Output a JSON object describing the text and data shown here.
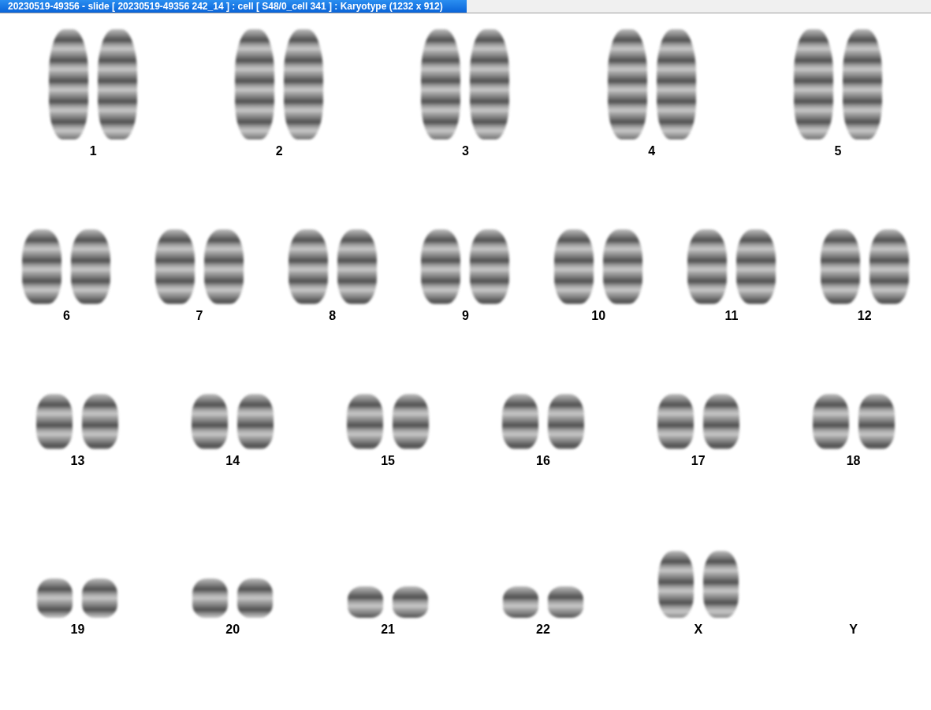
{
  "window": {
    "title": "20230519-49356 - slide [ 20230519-49356 242_14 ] : cell [ S48/0_cell 341 ] : Karyotype  (1232 x 912)"
  },
  "rows": [
    {
      "pairs": [
        {
          "label": "1",
          "has_images": true
        },
        {
          "label": "2",
          "has_images": true
        },
        {
          "label": "3",
          "has_images": true
        },
        {
          "label": "4",
          "has_images": true
        },
        {
          "label": "5",
          "has_images": true
        }
      ]
    },
    {
      "pairs": [
        {
          "label": "6",
          "has_images": true
        },
        {
          "label": "7",
          "has_images": true
        },
        {
          "label": "8",
          "has_images": true
        },
        {
          "label": "9",
          "has_images": true
        },
        {
          "label": "10",
          "has_images": true
        },
        {
          "label": "11",
          "has_images": true
        },
        {
          "label": "12",
          "has_images": true
        }
      ]
    },
    {
      "pairs": [
        {
          "label": "13",
          "has_images": true
        },
        {
          "label": "14",
          "has_images": true
        },
        {
          "label": "15",
          "has_images": true
        },
        {
          "label": "16",
          "has_images": true
        },
        {
          "label": "17",
          "has_images": true
        },
        {
          "label": "18",
          "has_images": true
        }
      ]
    },
    {
      "pairs": [
        {
          "label": "19",
          "has_images": true
        },
        {
          "label": "20",
          "has_images": true
        },
        {
          "label": "21",
          "has_images": true
        },
        {
          "label": "22",
          "has_images": true
        },
        {
          "label": "X",
          "has_images": true
        },
        {
          "label": "Y",
          "has_images": false
        }
      ]
    }
  ]
}
